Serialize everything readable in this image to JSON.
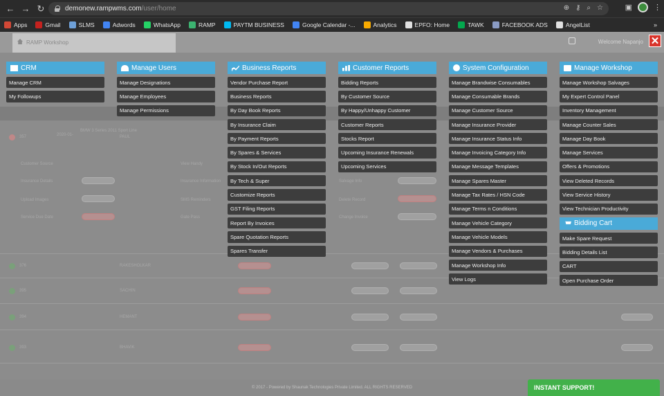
{
  "browser": {
    "url_domain": "demonew.rampwms.com",
    "url_path": "/user/home",
    "bookmarks": [
      {
        "label": "Apps",
        "color": "#d14836"
      },
      {
        "label": "Gmail",
        "color": "#c5221f"
      },
      {
        "label": "SLMS",
        "color": "#6ea0d8"
      },
      {
        "label": "Adwords",
        "color": "#4285f4"
      },
      {
        "label": "WhatsApp",
        "color": "#25d366"
      },
      {
        "label": "RAMP",
        "color": "#3cb371"
      },
      {
        "label": "PAYTM BUSINESS",
        "color": "#00baf2"
      },
      {
        "label": "Google Calendar -...",
        "color": "#4285f4"
      },
      {
        "label": "Analytics",
        "color": "#f9ab00"
      },
      {
        "label": "EPFO: Home",
        "color": "#e0e0e0"
      },
      {
        "label": "TAWK",
        "color": "#03a84e"
      },
      {
        "label": "FACEBOOK ADS",
        "color": "#8a9bc4"
      },
      {
        "label": "AngelList",
        "color": "#e0e0e0"
      }
    ],
    "more": "»"
  },
  "header": {
    "workshop_title": "RAMP Workshop",
    "welcome": "Welcome Napanjo"
  },
  "background": {
    "row_id": "357",
    "row_date": "2020-01-",
    "vehicle": "BMW 3 Series 2011 Sport Line",
    "customer_name": "PAUL",
    "labels": [
      "Customer Source",
      "Insurance Details",
      "Upload Images",
      "Service Due Date",
      "View Handy",
      "Insurance Information",
      "SMS Reminders",
      "Gate Pass",
      "Salvage Info",
      "Delete Record",
      "Change Invoice"
    ],
    "rows": [
      {
        "id": "376",
        "name": "RAKESHOLKAR",
        "status": "green"
      },
      {
        "id": "395",
        "name": "SACHIN",
        "status": "green"
      },
      {
        "id": "394",
        "name": "HEMANT",
        "status": "green"
      },
      {
        "id": "393",
        "name": "BHAVIK",
        "status": "green"
      }
    ],
    "footer": "© 2017 - Powered by Shaunak Technologies Private Limited. ALL RIGHTS RESERVED"
  },
  "support_label": "INSTANT SUPPORT!",
  "menu": {
    "crm": {
      "title": "CRM",
      "items": [
        "Manage CRM",
        "My Followups"
      ]
    },
    "users": {
      "title": "Manage Users",
      "items": [
        "Manage Designations",
        "Manage Employees",
        "Manage Permissions"
      ]
    },
    "business": {
      "title": "Business Reports",
      "items": [
        "Vendor Purchase Report",
        "Business Reports",
        "By Day Book Reports",
        "By Insurance Claim",
        "By Payment Reports",
        "By Spares & Services",
        "By Stock In/Out Reports",
        "By Tech & Super",
        "Customize Reports",
        "GST Filing Reports",
        "Report By Invoices",
        "Spare Quotation Reports",
        "Spares Transfer"
      ]
    },
    "customer": {
      "title": "Customer Reports",
      "items": [
        "Bidding Reports",
        "By Customer Source",
        "By Happy/Unhappy Customer",
        "Customer Reports",
        "Stocks Report",
        "Upcoming Insurance Renewals",
        "Upcoming Services"
      ]
    },
    "system": {
      "title": "System Configuration",
      "items": [
        "Manage Brandwise Consumables",
        "Manage Consumable Brands",
        "Manage Customer Source",
        "Manage Insurance Provider",
        "Manage Insurance Status Info",
        "Manage Invoicing Category Info",
        "Manage Message Templates",
        "Manage Spares Master",
        "Manage Tax Rates / HSN Code",
        "Manage Terms n Conditions",
        "Manage Vehicle Category",
        "Manage Vehicle Models",
        "Manage Vendors & Purchases",
        "Manage Workshop Info",
        "View Logs"
      ]
    },
    "workshop": {
      "title": "Manage Workshop",
      "items": [
        "Manage Workshop Salvages",
        "My Expert Control Panel",
        "Inventory Management",
        "Manage Counter Sales",
        "Manage Day Book",
        "Manage Services",
        "Offers & Promotions",
        "View Deleted Records",
        "View Service History",
        "View Technician Productivity"
      ]
    },
    "bidding": {
      "title": "Bidding Cart",
      "items": [
        "Make Spare Request",
        "Bidding Details List",
        "CART",
        "Open Purchase Order"
      ]
    }
  },
  "colors": {
    "menu_header": "#4aaad8",
    "menu_item": "#3d3d3d",
    "support": "#42b14a",
    "close": "#d9342b"
  }
}
